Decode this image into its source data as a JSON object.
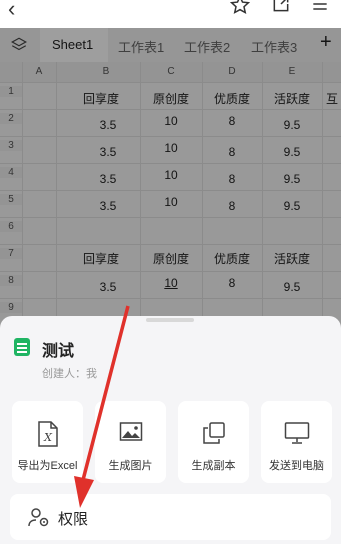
{
  "tabs": [
    "Sheet1",
    "工作表1",
    "工作表2",
    "工作表3"
  ],
  "add_sheet_label": "+",
  "columns": [
    "A",
    "B",
    "C",
    "D",
    "E"
  ],
  "rows": [
    "1",
    "2",
    "3",
    "4",
    "5",
    "6",
    "7",
    "8",
    "9"
  ],
  "cells": {
    "r1": [
      "回享度",
      "原创度",
      "优质度",
      "活跃度",
      "互"
    ],
    "r2": [
      "3.5",
      "10",
      "8",
      "9.5"
    ],
    "r3": [
      "3.5",
      "10",
      "8",
      "9.5"
    ],
    "r4": [
      "3.5",
      "10",
      "8",
      "9.5"
    ],
    "r5": [
      "3.5",
      "10",
      "8",
      "9.5"
    ],
    "r7": [
      "回享度",
      "原创度",
      "优质度",
      "活跃度"
    ],
    "r8": [
      "3.5",
      "10",
      "8",
      "9.5"
    ]
  },
  "document": {
    "title": "测试",
    "creator_label": "创建人：",
    "creator_value": "我"
  },
  "actions": [
    {
      "label": "导出为Excel",
      "icon": "excel-export-icon"
    },
    {
      "label": "生成图片",
      "icon": "image-icon"
    },
    {
      "label": "生成副本",
      "icon": "copy-icon"
    },
    {
      "label": "发送到电脑",
      "icon": "monitor-icon"
    }
  ],
  "permission": {
    "label": "权限",
    "icon": "user-settings-icon"
  },
  "colors": {
    "accent_green": "#1fb463",
    "arrow_red": "#e0312b",
    "overlay": "#000000"
  }
}
